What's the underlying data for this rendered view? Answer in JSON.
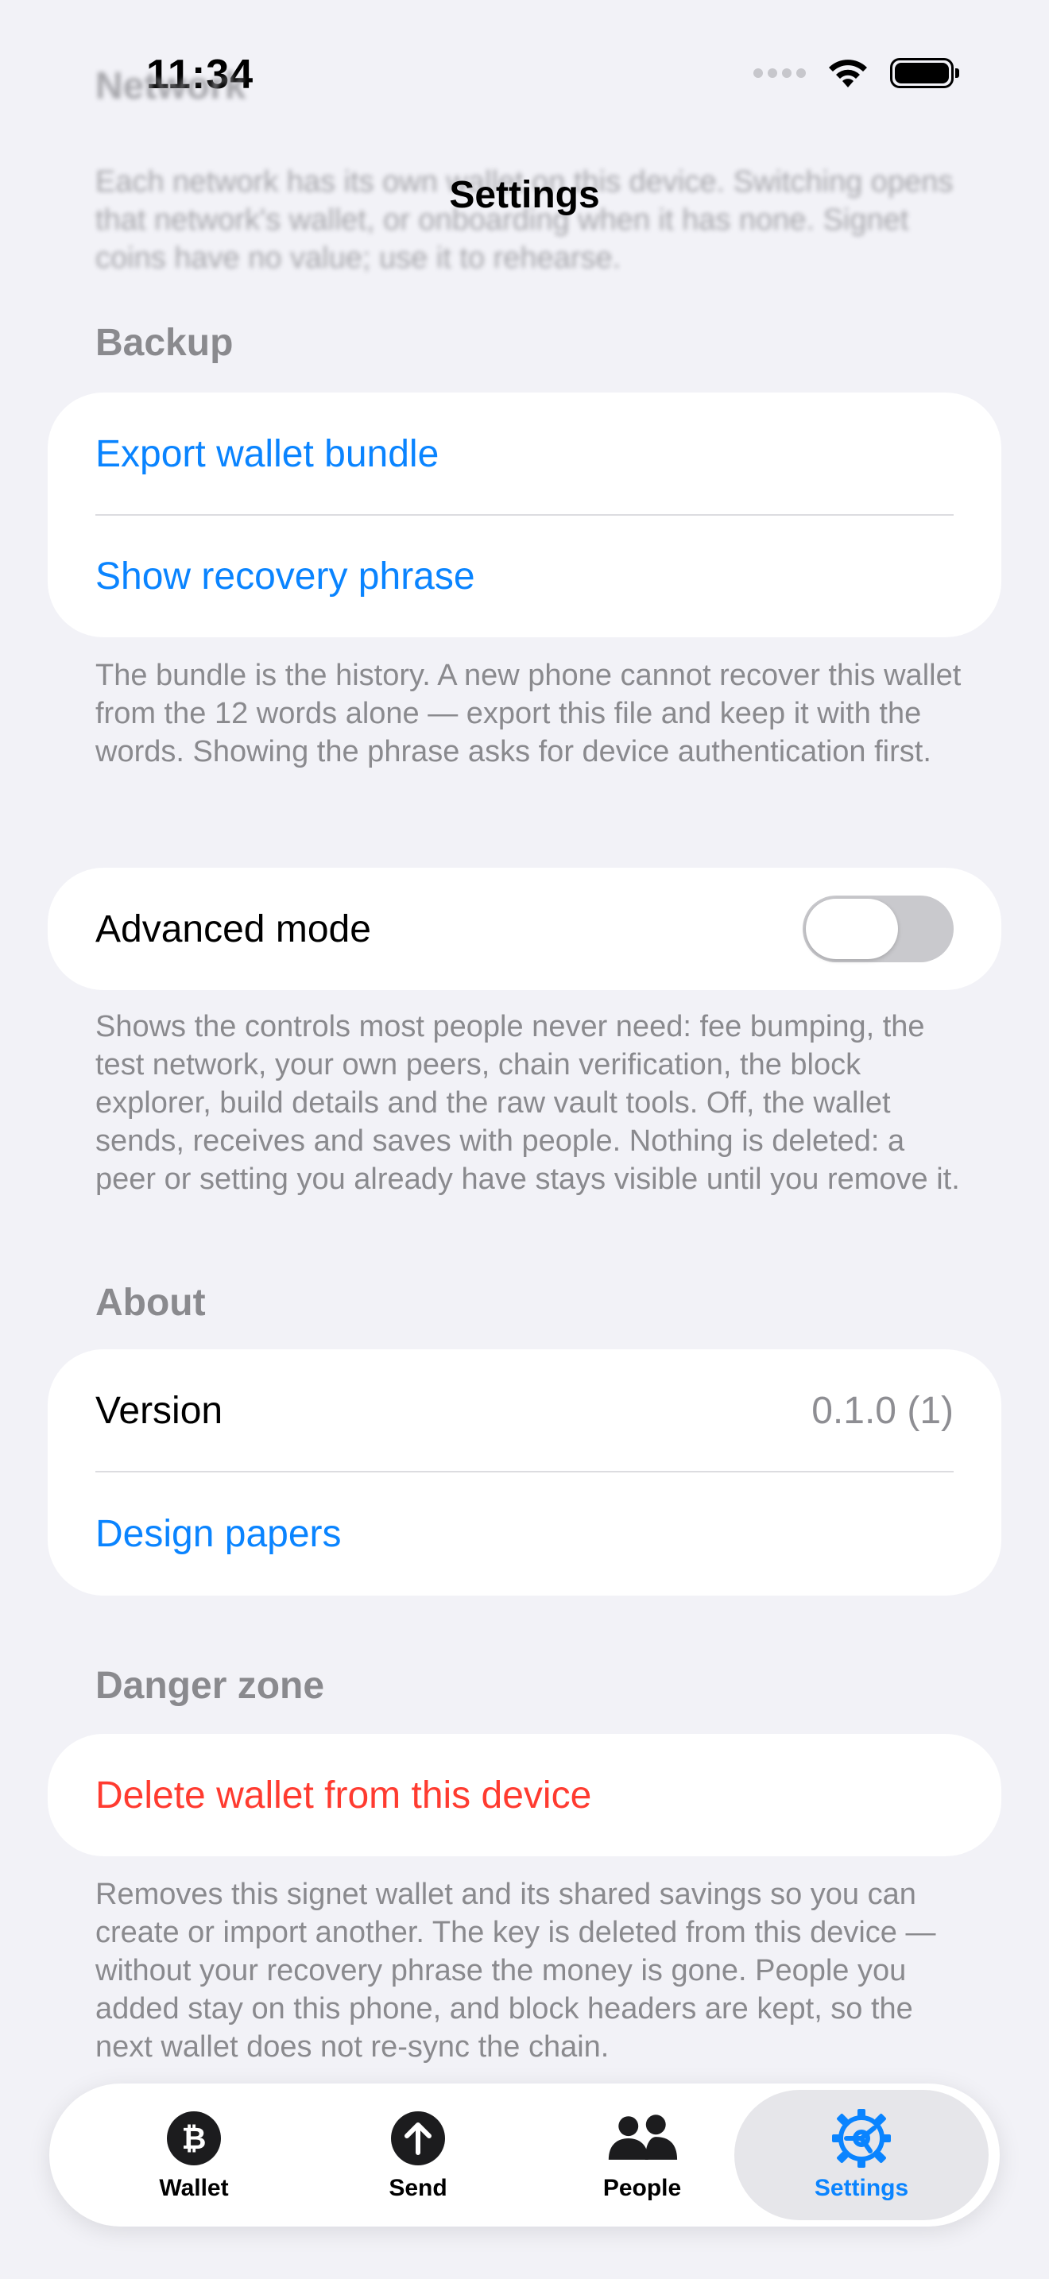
{
  "status_bar": {
    "time": "11:34"
  },
  "behind_header": {
    "title": "Network",
    "text": "Each network has its own wallet on this device. Switching opens that network's wallet, or onboarding when it has none. Signet coins have no value; use it to rehearse."
  },
  "nav": {
    "title": "Settings"
  },
  "backup": {
    "header": "Backup",
    "export_label": "Export wallet bundle",
    "recovery_label": "Show recovery phrase",
    "footnote": "The bundle is the history. A new phone cannot recover this wallet from the 12 words alone — export this file and keep it with the words. Showing the phrase asks for device authentication first."
  },
  "advanced": {
    "label": "Advanced mode",
    "enabled": false,
    "footnote": "Shows the controls most people never need: fee bumping, the test network, your own peers, chain verification, the block explorer, build details and the raw vault tools. Off, the wallet sends, receives and saves with people. Nothing is deleted: a peer or setting you already have stays visible until you remove it."
  },
  "about": {
    "header": "About",
    "version_label": "Version",
    "version_value": "0.1.0 (1)",
    "design_papers_label": "Design papers"
  },
  "danger": {
    "header": "Danger zone",
    "delete_label": "Delete wallet from this device",
    "footnote": "Removes this signet wallet and its shared savings so you can create or import another. The key is deleted from this device — without your recovery phrase the money is gone. People you added stay on this phone, and block headers are kept, so the next wallet does not re-sync the chain."
  },
  "tabs": [
    {
      "label": "Wallet",
      "icon": "bitcoin-icon"
    },
    {
      "label": "Send",
      "icon": "arrow-up-circle-icon"
    },
    {
      "label": "People",
      "icon": "people-icon"
    },
    {
      "label": "Settings",
      "icon": "gear-icon",
      "active": true
    }
  ],
  "colors": {
    "accent": "#0a84ff",
    "danger": "#ff3b30",
    "background": "#f2f2f7"
  }
}
